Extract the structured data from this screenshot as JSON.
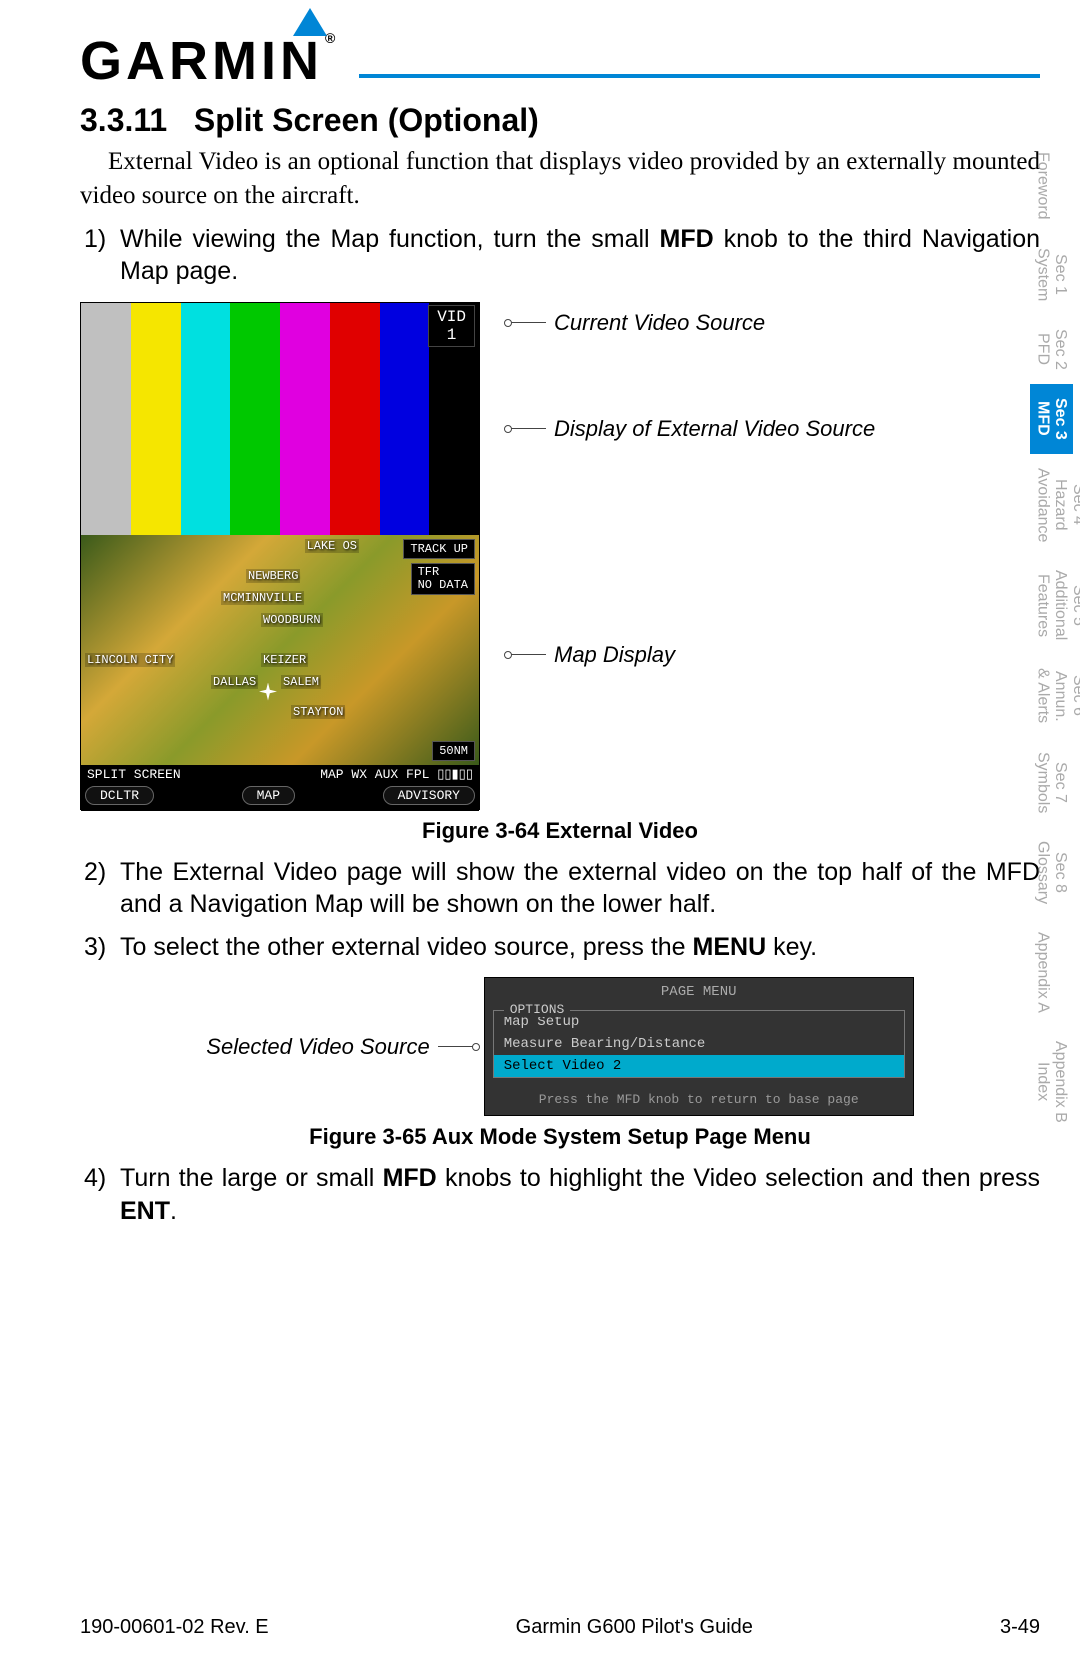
{
  "brand": "GARMIN",
  "section_number": "3.3.11",
  "section_title": "Split Screen (Optional)",
  "intro": "External Video is an optional function that displays video provided by an externally mounted video source on the aircraft.",
  "steps": {
    "s1_num": "1)",
    "s1_a": "While viewing the Map function, turn the small ",
    "s1_b": "MFD",
    "s1_c": " knob to the third Navigation Map page.",
    "s2_num": "2)",
    "s2": "The External Video page will show the external video on the top half of the MFD and a Navigation Map will be shown on the lower half.",
    "s3_num": "3)",
    "s3_a": "To select the other external video source, press the ",
    "s3_b": "MENU",
    "s3_c": " key.",
    "s4_num": "4)",
    "s4_a": "Turn the large or small ",
    "s4_b": "MFD",
    "s4_c": " knobs to highlight the Video selection and then press ",
    "s4_d": "ENT",
    "s4_e": "."
  },
  "fig1": {
    "vid_badge_line1": "VID",
    "vid_badge_line2": "1",
    "annot1": "Current Video Source",
    "annot2": "Display of External Video Source",
    "annot3": "Map Display",
    "map_cities": {
      "c1": "LAKE OS",
      "c2": "NEWBERG",
      "c3": "MCMINNVILLE",
      "c4": "WOODBURN",
      "c5": "LINCOLN CITY",
      "c6": "KEIZER",
      "c7": "DALLAS",
      "c8": "SALEM",
      "c9": "STAYTON"
    },
    "btn_track": "TRACK UP",
    "btn_tfr1": "TFR",
    "btn_tfr2": "NO DATA",
    "scale": "50NM",
    "status_left": "SPLIT SCREEN",
    "status_mid": "MAP WX AUX FPL ▯▯▮▯▯",
    "softkey1": "DCLTR",
    "softkey2": "MAP",
    "softkey3": "ADVISORY",
    "caption": "Figure 3-64  External Video"
  },
  "fig2": {
    "left_annot": "Selected Video Source",
    "title": "PAGE MENU",
    "box_label": "OPTIONS",
    "item1": "Map Setup",
    "item2": "Measure Bearing/Distance",
    "item3": "Select Video 2",
    "foot": "Press the MFD knob to return to base page",
    "caption": "Figure 3-65  Aux Mode System Setup Page Menu"
  },
  "tabs": {
    "t0": "Foreword",
    "t1a": "Sec 1",
    "t1b": "System",
    "t2a": "Sec 2",
    "t2b": "PFD",
    "t3a": "Sec 3",
    "t3b": "MFD",
    "t4a": "Sec 4",
    "t4b": "Hazard",
    "t4c": "Avoidance",
    "t5a": "Sec 5",
    "t5b": "Additional",
    "t5c": "Features",
    "t6a": "Sec 6",
    "t6b": "Annun.",
    "t6c": "& Alerts",
    "t7a": "Sec 7",
    "t7b": "Symbols",
    "t8a": "Sec 8",
    "t8b": "Glossary",
    "t9": "Appendix A",
    "t10a": "Appendix B",
    "t10b": "Index"
  },
  "footer": {
    "left": "190-00601-02  Rev. E",
    "center": "Garmin G600 Pilot's Guide",
    "right": "3-49"
  },
  "color_bars": [
    "#c0c0c0",
    "#f5e600",
    "#00e0e0",
    "#00c800",
    "#e000e0",
    "#e00000",
    "#0000e0",
    "#000000"
  ]
}
